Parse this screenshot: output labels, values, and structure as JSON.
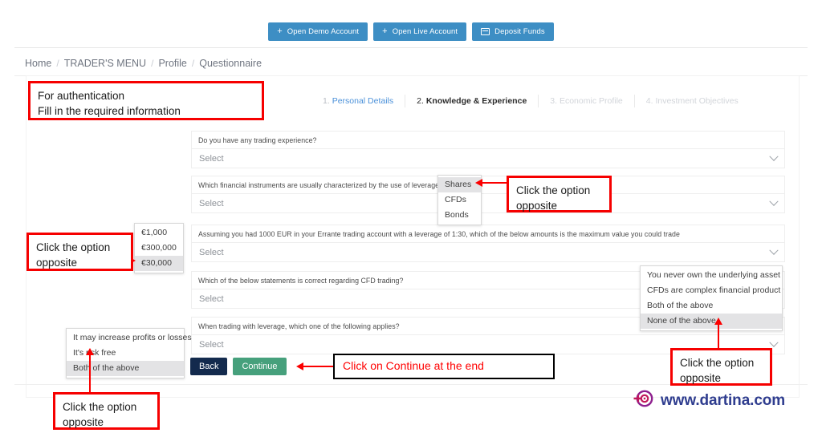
{
  "topbar": {
    "buttons": [
      {
        "label": "Open Demo Account",
        "icon": "plus-icon"
      },
      {
        "label": "Open Live Account",
        "icon": "plus-icon"
      },
      {
        "label": "Deposit Funds",
        "icon": "card-icon"
      }
    ],
    "accent_color": "#3d8ec4"
  },
  "breadcrumb": {
    "items": [
      "Home",
      "TRADER'S MENU",
      "Profile",
      "Questionnaire"
    ],
    "separator": "/"
  },
  "wizard": {
    "steps": [
      {
        "num": "1.",
        "label": "Personal Details",
        "state": "done"
      },
      {
        "num": "2.",
        "label": "Knowledge & Experience",
        "state": "current"
      },
      {
        "num": "3.",
        "label": "Economic Profile",
        "state": "upcoming"
      },
      {
        "num": "4.",
        "label": "Investment Objectives",
        "state": "upcoming"
      }
    ]
  },
  "questions": [
    {
      "label": "Do you have any trading experience?",
      "value": "Select"
    },
    {
      "label": "Which financial instruments are usually characterized by the use of leverage?",
      "value": "Select"
    },
    {
      "label": "Assuming you had 1000 EUR in your Errante trading account with a leverage of 1:30, which of the below amounts is the maximum value you could trade",
      "value": "Select"
    },
    {
      "label": "Which of the below statements is correct regarding CFD trading?",
      "value": "Select"
    },
    {
      "label": "When trading with leverage, which one of the following applies?",
      "value": "Select"
    }
  ],
  "dropdowns": {
    "instruments": {
      "options": [
        "Shares",
        "CFDs",
        "Bonds"
      ],
      "selected": "Shares"
    },
    "amounts": {
      "options": [
        "€1,000",
        "€300,000",
        "€30,000"
      ],
      "selected": "€30,000"
    },
    "cfd_statements": {
      "options": [
        "You never own the underlying asset",
        "CFDs are complex financial product",
        "Both of the above",
        "None of the above"
      ],
      "selected": "None of the above"
    },
    "leverage_applies": {
      "options": [
        "It may increase profits or losses",
        "It's risk free",
        "Both of the above"
      ],
      "selected": "Both of the above"
    }
  },
  "form_buttons": {
    "back": "Back",
    "continue": "Continue",
    "back_color": "#132a4d",
    "continue_color": "#46a07c"
  },
  "annotations": {
    "auth": "For authentication\nFill in the required information",
    "auth_line1": "For authentication",
    "auth_line2": "Fill in the required information",
    "instruments_hint_l1": "Click the option",
    "instruments_hint_l2": "opposite",
    "amounts_hint_l1": "Click the option",
    "amounts_hint_l2": "opposite",
    "cfd_hint_l1": "Click the option",
    "cfd_hint_l2": "opposite",
    "leverage_hint_l1": "Click the option",
    "leverage_hint_l2": "opposite",
    "continue_hint": "Click on Continue at the end",
    "red_color": "#f60000",
    "black_color": "#000000"
  },
  "watermark": {
    "text": "www.dartina.com",
    "logo": "target-arrow-icon",
    "text_color": "#2f3d8f"
  }
}
